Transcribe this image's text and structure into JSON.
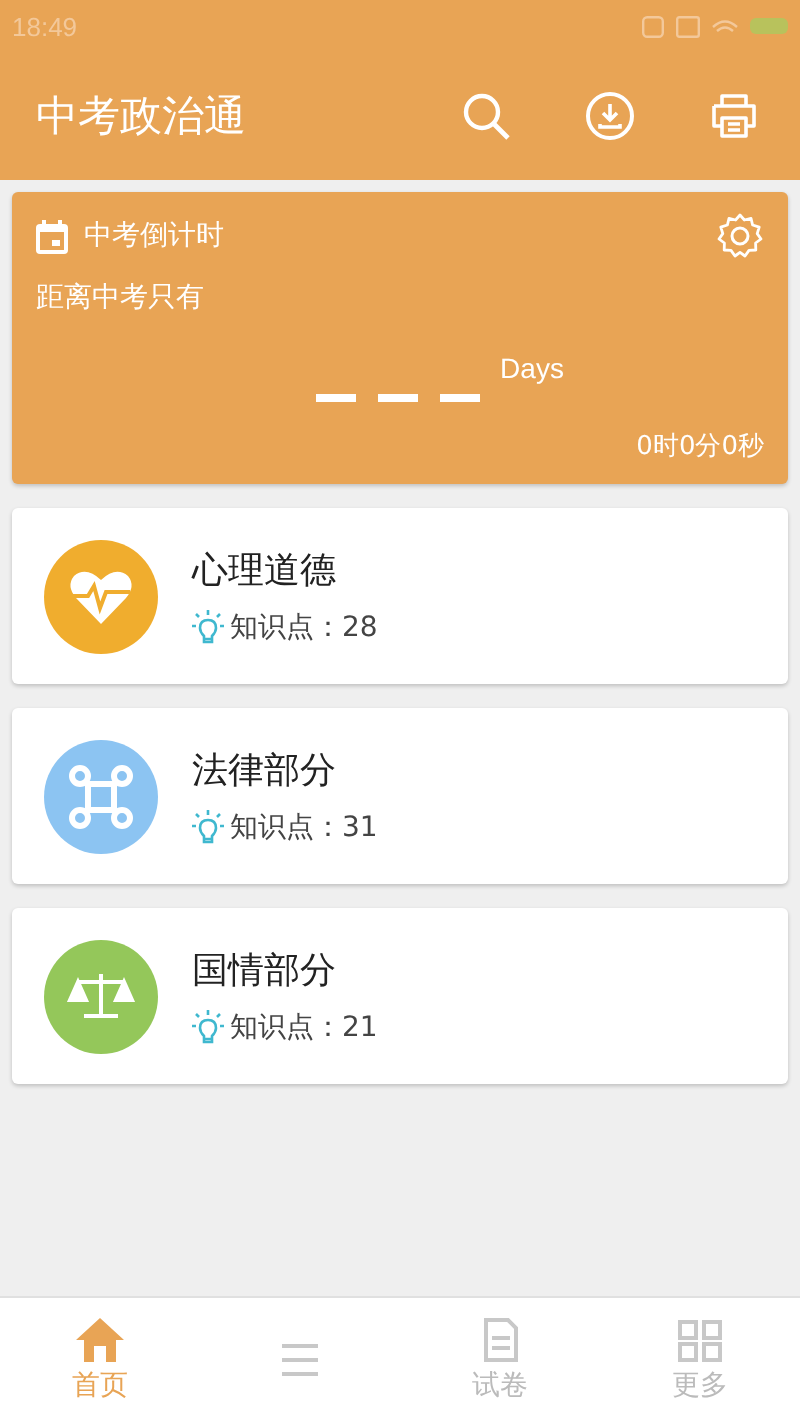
{
  "status_bar": {
    "time": "18:49"
  },
  "app_bar": {
    "title": "中考政治通"
  },
  "countdown": {
    "title": "中考倒计时",
    "subtitle": "距离中考只有",
    "days_unit": "Days",
    "time_left": "0时0分0秒"
  },
  "subjects": [
    {
      "name": "心理道德",
      "count_label": "知识点：28",
      "kind": "heart",
      "color": "#f0ad2e"
    },
    {
      "name": "法律部分",
      "count_label": "知识点：31",
      "kind": "command",
      "color": "#8cc4f2"
    },
    {
      "name": "国情部分",
      "count_label": "知识点：21",
      "kind": "scale",
      "color": "#94c75a"
    }
  ],
  "bottom_nav": [
    {
      "label": "首页",
      "kind": "home",
      "selected": true
    },
    {
      "kind": "list",
      "selected": false
    },
    {
      "label": "试卷",
      "kind": "paper",
      "selected": false
    },
    {
      "label": "更多",
      "kind": "more",
      "selected": false
    }
  ]
}
